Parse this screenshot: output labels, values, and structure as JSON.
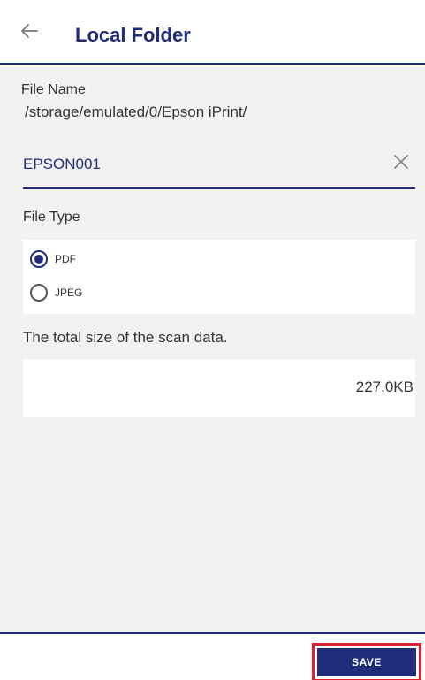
{
  "header": {
    "back_icon": "arrow-left-icon",
    "title": "Local Folder"
  },
  "file_name": {
    "label": "File Name",
    "path": "/storage/emulated/0/Epson iPrint/",
    "value": "EPSON001",
    "clear_icon": "close-icon"
  },
  "file_type": {
    "label": "File Type",
    "options": [
      {
        "label": "PDF",
        "selected": true
      },
      {
        "label": "JPEG",
        "selected": false
      }
    ]
  },
  "scan_size": {
    "label": "The total size of the scan data.",
    "value": "227.0KB"
  },
  "footer": {
    "save_label": "SAVE"
  },
  "colors": {
    "accent": "#1f2c7a",
    "highlight": "#e0202e",
    "background": "#f2f2f2"
  }
}
